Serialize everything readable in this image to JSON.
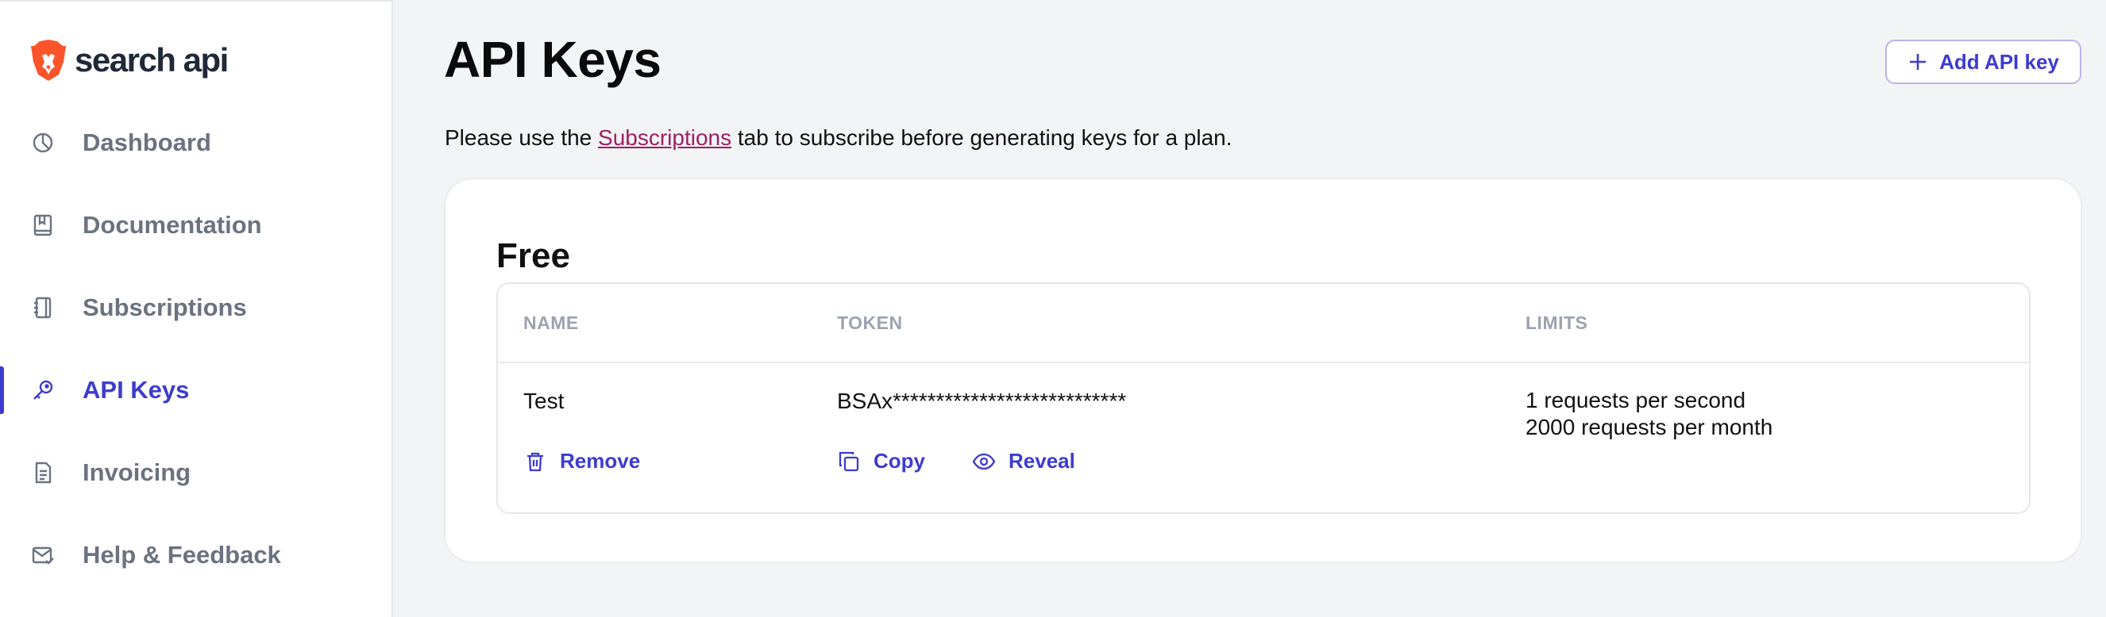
{
  "brand": {
    "name": "search api",
    "accent": "#3c3ccf",
    "logo_color": "#fb542b"
  },
  "sidebar": {
    "items": [
      {
        "label": "Dashboard",
        "icon": "pie-chart-icon",
        "active": false
      },
      {
        "label": "Documentation",
        "icon": "book-icon",
        "active": false
      },
      {
        "label": "Subscriptions",
        "icon": "notebook-icon",
        "active": false
      },
      {
        "label": "API Keys",
        "icon": "key-icon",
        "active": true
      },
      {
        "label": "Invoicing",
        "icon": "invoice-icon",
        "active": false
      },
      {
        "label": "Help & Feedback",
        "icon": "mail-icon",
        "active": false
      }
    ]
  },
  "main": {
    "title": "API Keys",
    "add_button_label": "Add API key",
    "notice": {
      "before": "Please use the ",
      "link": "Subscriptions",
      "after": " tab to subscribe before generating keys for a plan."
    },
    "plan": {
      "title": "Free",
      "columns": [
        "NAME",
        "TOKEN",
        "LIMITS"
      ],
      "rows": [
        {
          "name": "Test",
          "token": "BSAx***************************",
          "limits": [
            "1 requests per second",
            "2000 requests per month"
          ],
          "actions": {
            "remove": "Remove",
            "copy": "Copy",
            "reveal": "Reveal"
          }
        }
      ]
    }
  }
}
